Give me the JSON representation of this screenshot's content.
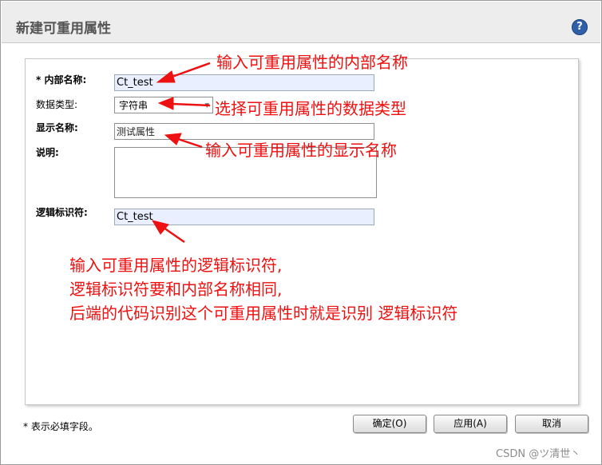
{
  "dialog": {
    "title": "新建可重用属性",
    "help_icon_glyph": "?"
  },
  "form": {
    "internal_name_label": "* 内部名称:",
    "internal_name_value": "Ct_test",
    "data_type_label": "数据类型:",
    "data_type_value": "字符串",
    "display_name_label": "显示名称:",
    "display_name_value": "测试属性",
    "description_label": "说明:",
    "description_value": "",
    "logical_id_label": "逻辑标识符:",
    "logical_id_value": "Ct_test"
  },
  "annotations": {
    "internal_name": "输入可重用属性的内部名称",
    "data_type": "选择可重用属性的数据类型",
    "display_name": "输入可重用属性的显示名称",
    "logical_line1": "输入可重用属性的逻辑标识符,",
    "logical_line2": "逻辑标识符要和内部名称相同,",
    "logical_line3": "后端的代码识别这个可重用属性时就是识别 逻辑标识符",
    "color": "#ee1111"
  },
  "footer": {
    "required_note": "* 表示必填字段。",
    "ok_label": "确定(O)",
    "apply_label": "应用(A)",
    "cancel_label": "取消"
  },
  "watermark": "CSDN @ツ清世丶",
  "icons": {
    "help": "help-icon",
    "dropdown": "chevron-down-icon"
  }
}
